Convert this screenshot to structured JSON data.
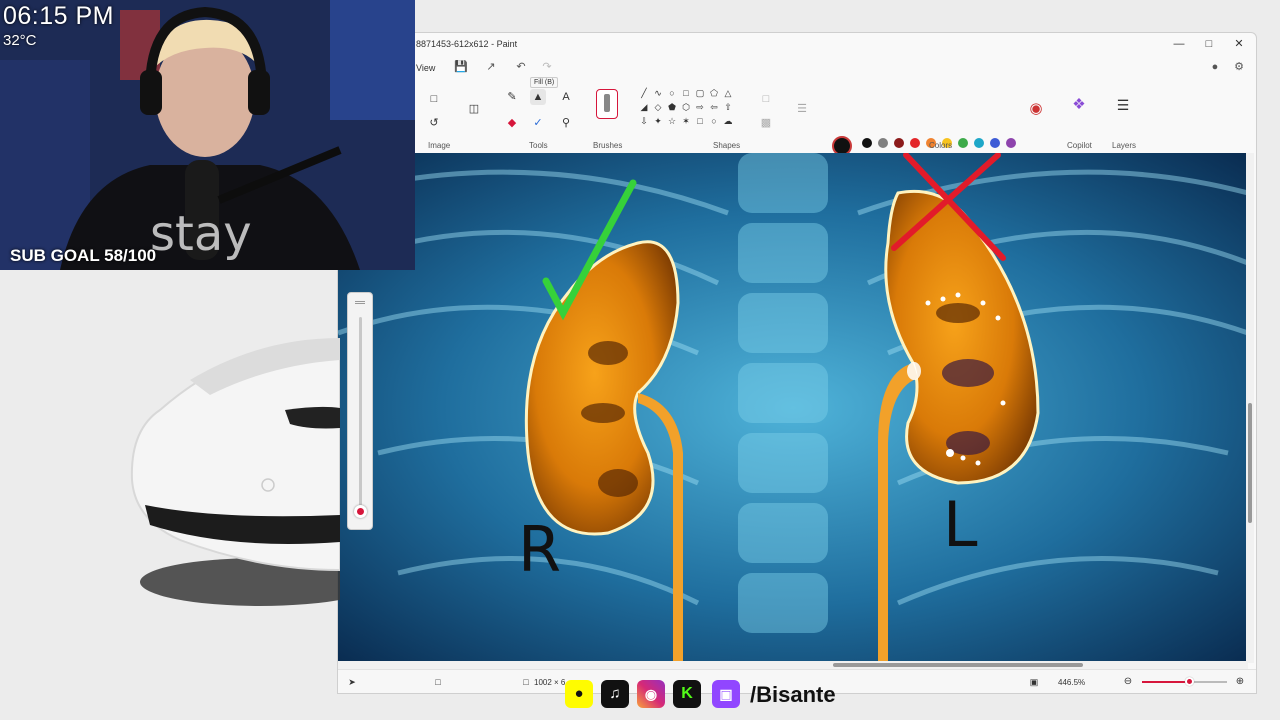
{
  "overlay": {
    "clock": "06:15 PM",
    "temperature": "32°C",
    "sub_goal": "SUB GOAL 58/100",
    "social_handle": "/Bisante"
  },
  "paint": {
    "title": "8871453-612x612 - Paint",
    "menu_view": "View",
    "tooltip": "Fill (B)",
    "groups": {
      "image": "Image",
      "tools": "Tools",
      "brushes": "Brushes",
      "shapes": "Shapes",
      "colors": "Colors",
      "copilot": "Copilot",
      "layers": "Layers"
    },
    "palette_row1": [
      "#111111",
      "#7f7f7f",
      "#8b1a1a",
      "#e3262a",
      "#f08330",
      "#f7c31e",
      "#3dab4a",
      "#1ea7c8",
      "#3d5bd6",
      "#8e44ad"
    ],
    "palette_row2": [
      "#ffffff",
      "#c3c3c3",
      "#b5734a",
      "#f6a5c0",
      "#fbd18b",
      "#fff27a",
      "#b5e66b",
      "#9fd8f0",
      "#7ea5e8",
      "#c8a8e0"
    ],
    "canvas_labels": {
      "right": "R",
      "left": "L"
    },
    "status": {
      "dimensions": "1002 × 6",
      "zoom": "446.5%"
    },
    "accent": "#d6163b"
  }
}
